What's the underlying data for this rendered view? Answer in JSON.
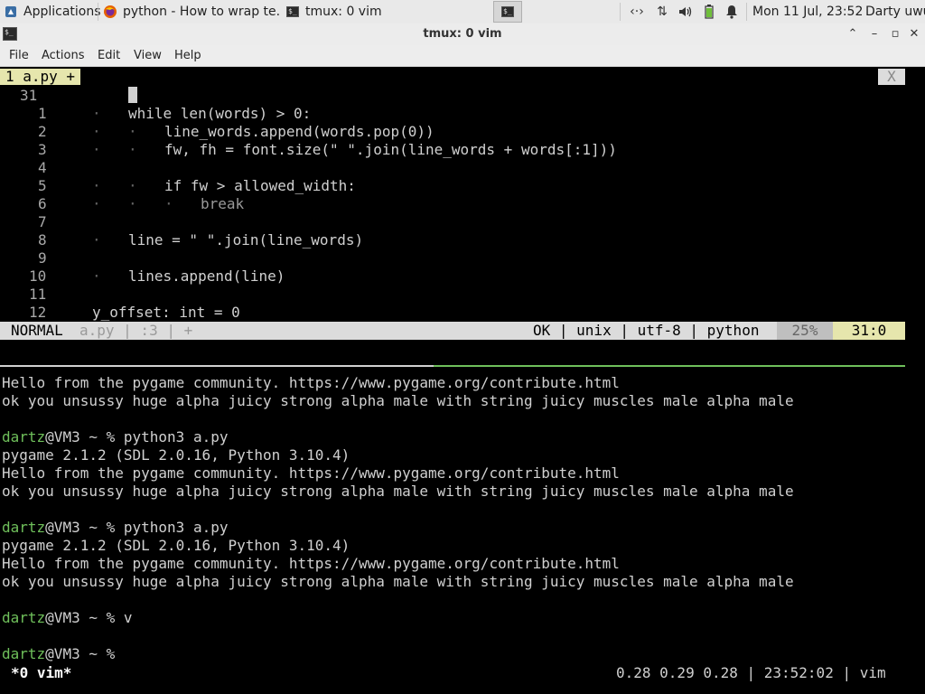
{
  "panel": {
    "applications": "Applications",
    "tasks": [
      {
        "label": "python - How to wrap te...",
        "icon": "firefox-icon"
      },
      {
        "label": "tmux: 0 vim",
        "icon": "terminal-icon"
      }
    ],
    "clock": "Mon 11 Jul, 23:52",
    "user": "Darty uwu",
    "icons": [
      "network-arrows-icon",
      "network-transfer-icon",
      "volume-icon",
      "battery-icon",
      "notification-bell-icon"
    ]
  },
  "window": {
    "title": "tmux: 0 vim",
    "menu": [
      "File",
      "Actions",
      "Edit",
      "View",
      "Help"
    ]
  },
  "vim": {
    "tab_label": "1 a.py +",
    "tab_close": "X",
    "current_line": "31",
    "lines": [
      {
        "n": "1",
        "indent": 2,
        "text": "while len(words) > 0:"
      },
      {
        "n": "2",
        "indent": 3,
        "text": "line_words.append(words.pop(0))"
      },
      {
        "n": "3",
        "indent": 3,
        "text": "fw, fh = font.size(\" \".join(line_words + words[:1]))"
      },
      {
        "n": "4",
        "indent": 0,
        "text": ""
      },
      {
        "n": "5",
        "indent": 3,
        "text": "if fw > allowed_width:"
      },
      {
        "n": "6",
        "indent": 4,
        "text": "break"
      },
      {
        "n": "7",
        "indent": 0,
        "text": ""
      },
      {
        "n": "8",
        "indent": 2,
        "text": "line = \" \".join(line_words)"
      },
      {
        "n": "9",
        "indent": 0,
        "text": ""
      },
      {
        "n": "10",
        "indent": 2,
        "text": "lines.append(line)"
      },
      {
        "n": "11",
        "indent": 0,
        "text": ""
      },
      {
        "n": "12",
        "indent": 1,
        "text": "y_offset: int = 0"
      }
    ],
    "status": {
      "mode": "NORMAL",
      "file": "a.py | :3 | +",
      "info": "OK | unix | utf-8 | python",
      "percent": "25%",
      "position": "31:0"
    }
  },
  "shell": {
    "lines": [
      {
        "type": "out",
        "text": "Hello from the pygame community. https://www.pygame.org/contribute.html"
      },
      {
        "type": "out",
        "text": "ok you unsussy huge alpha juicy strong alpha male with string juicy muscles male alpha male"
      },
      {
        "type": "blank",
        "text": ""
      },
      {
        "type": "prompt",
        "user": "dartz",
        "host": "@VM3 ~ % ",
        "cmd": "python3 a.py"
      },
      {
        "type": "out",
        "text": "pygame 2.1.2 (SDL 2.0.16, Python 3.10.4)"
      },
      {
        "type": "out",
        "text": "Hello from the pygame community. https://www.pygame.org/contribute.html"
      },
      {
        "type": "out",
        "text": "ok you unsussy huge alpha juicy strong alpha male with string juicy muscles male alpha male"
      },
      {
        "type": "blank",
        "text": ""
      },
      {
        "type": "prompt",
        "user": "dartz",
        "host": "@VM3 ~ % ",
        "cmd": "python3 a.py"
      },
      {
        "type": "out",
        "text": "pygame 2.1.2 (SDL 2.0.16, Python 3.10.4)"
      },
      {
        "type": "out",
        "text": "Hello from the pygame community. https://www.pygame.org/contribute.html"
      },
      {
        "type": "out",
        "text": "ok you unsussy huge alpha juicy strong alpha male with string juicy muscles male alpha male"
      },
      {
        "type": "blank",
        "text": ""
      },
      {
        "type": "prompt",
        "user": "dartz",
        "host": "@VM3 ~ % ",
        "cmd": "v"
      },
      {
        "type": "blank",
        "text": ""
      },
      {
        "type": "prompt",
        "user": "dartz",
        "host": "@VM3 ~ % ",
        "cmd": ""
      }
    ]
  },
  "tmux": {
    "window": "*0 vim*",
    "right": "0.28 0.29 0.28 | 23:52:02 | vim"
  }
}
